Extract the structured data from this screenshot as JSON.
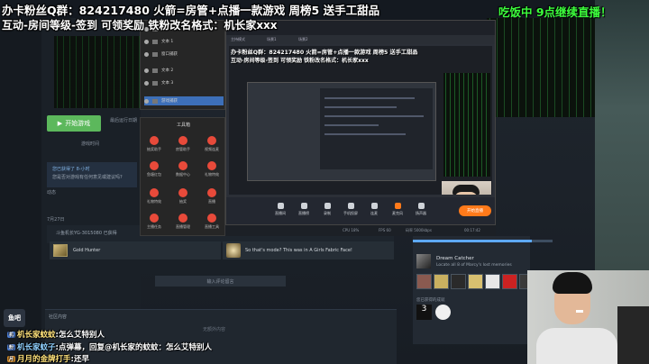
{
  "overlay": {
    "line1": "办卡粉丝Q群：824217480 火箭=房管+点播一款游戏 周榜5 送手工甜品",
    "line2": "互动-房间等级-签到 可领奖励 铁粉改名格式：机长家xxx",
    "right_banner": "吃饭中 9点继续直播！"
  },
  "steam": {
    "install_button": "开始游戏",
    "last_played": "最后运行日期",
    "play_time": "游戏时间",
    "news_title": "您已获得了 8-小时",
    "news_text": "您是否对游戏有任何意见或建议吗?",
    "activity": "动态",
    "date": "7月27日",
    "row_user": "斗鱼机长YG-3015080 已获得",
    "gold_hunter": "Gold Hunter",
    "fabric_text": "So that's mode? This was in A Girls Fabric Face!",
    "comment_placeholder": "输入评论留言",
    "community": "社区内容",
    "community_empty": "无额外内容",
    "dream_title": "Dream Catcher",
    "dream_desc": "Locate all 8 of Marcy's lost memories",
    "ach_label": "您已获得的成就",
    "ach_progress": 0.85
  },
  "file_panel": {
    "items": [
      "摄像头 1",
      "文本 1",
      "窗口捕获",
      "文本 2",
      "文本 3",
      "游戏捕获"
    ]
  },
  "toolbox": {
    "title": "工具箱",
    "tools": [
      "抽奖助手",
      "房管助手",
      "视频连麦",
      "鱼塘红包",
      "数据中心",
      "礼物特效",
      "礼物特效",
      "抽奖",
      "直播",
      "主播任务",
      "直播管理",
      "直播工具"
    ]
  },
  "preview": {
    "title": "【机长】直播 - 主持控制",
    "tabs": [
      "主持模式",
      "场景1",
      "场景2"
    ],
    "text1": "办卡粉丝Q群：824217480 火箭=房管+点播一款游戏 周榜5 送手工甜品",
    "text2": "互动-房间等级-签到 可领奖励 铁粉改名格式：机长家xxx",
    "buttons": [
      "直播间",
      "直播榜",
      "录制",
      "手机投屏",
      "连麦",
      "麦克风",
      "扬声器"
    ],
    "live_button": "开始直播",
    "status": [
      "CPU 18%",
      "FPS 60",
      "码率 5000kbps",
      "00:17:42"
    ]
  },
  "chat": [
    {
      "badge": "机",
      "name": "机长家蚊蚊",
      "message": "怎么艾特别人"
    },
    {
      "badge": "粉",
      "name": "机长家蚊子",
      "message": "点弹幕，回复@机长家的蚊蚊：怎么艾特别人"
    },
    {
      "badge": "月",
      "name": "月月的金牌打手",
      "message": "还早"
    }
  ],
  "corner_badge": "鱼吧"
}
